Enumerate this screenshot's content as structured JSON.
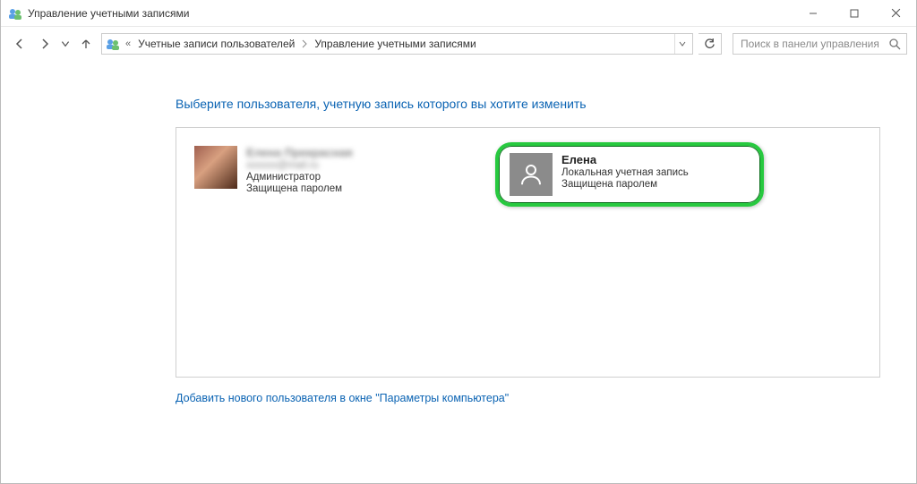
{
  "window": {
    "title": "Управление учетными записями"
  },
  "breadcrumb": {
    "segments": [
      "Учетные записи пользователей",
      "Управление учетными записями"
    ],
    "overflow": "«"
  },
  "search": {
    "placeholder": "Поиск в панели управления"
  },
  "main": {
    "heading": "Выберите пользователя, учетную запись которого вы хотите изменить"
  },
  "users": [
    {
      "name": "Елена Прекрасная",
      "email_masked": "xxxxxx@mail.ru",
      "role": "Администратор",
      "protection": "Защищена паролем",
      "avatar_kind": "photo",
      "blurred": true,
      "highlighted": false
    },
    {
      "name": "Елена",
      "account_type": "Локальная учетная запись",
      "protection": "Защищена паролем",
      "avatar_kind": "placeholder",
      "blurred": false,
      "highlighted": true
    }
  ],
  "footer": {
    "add_user_link": "Добавить нового пользователя в окне \"Параметры компьютера\""
  },
  "icons": {
    "app": "user-accounts-icon"
  }
}
